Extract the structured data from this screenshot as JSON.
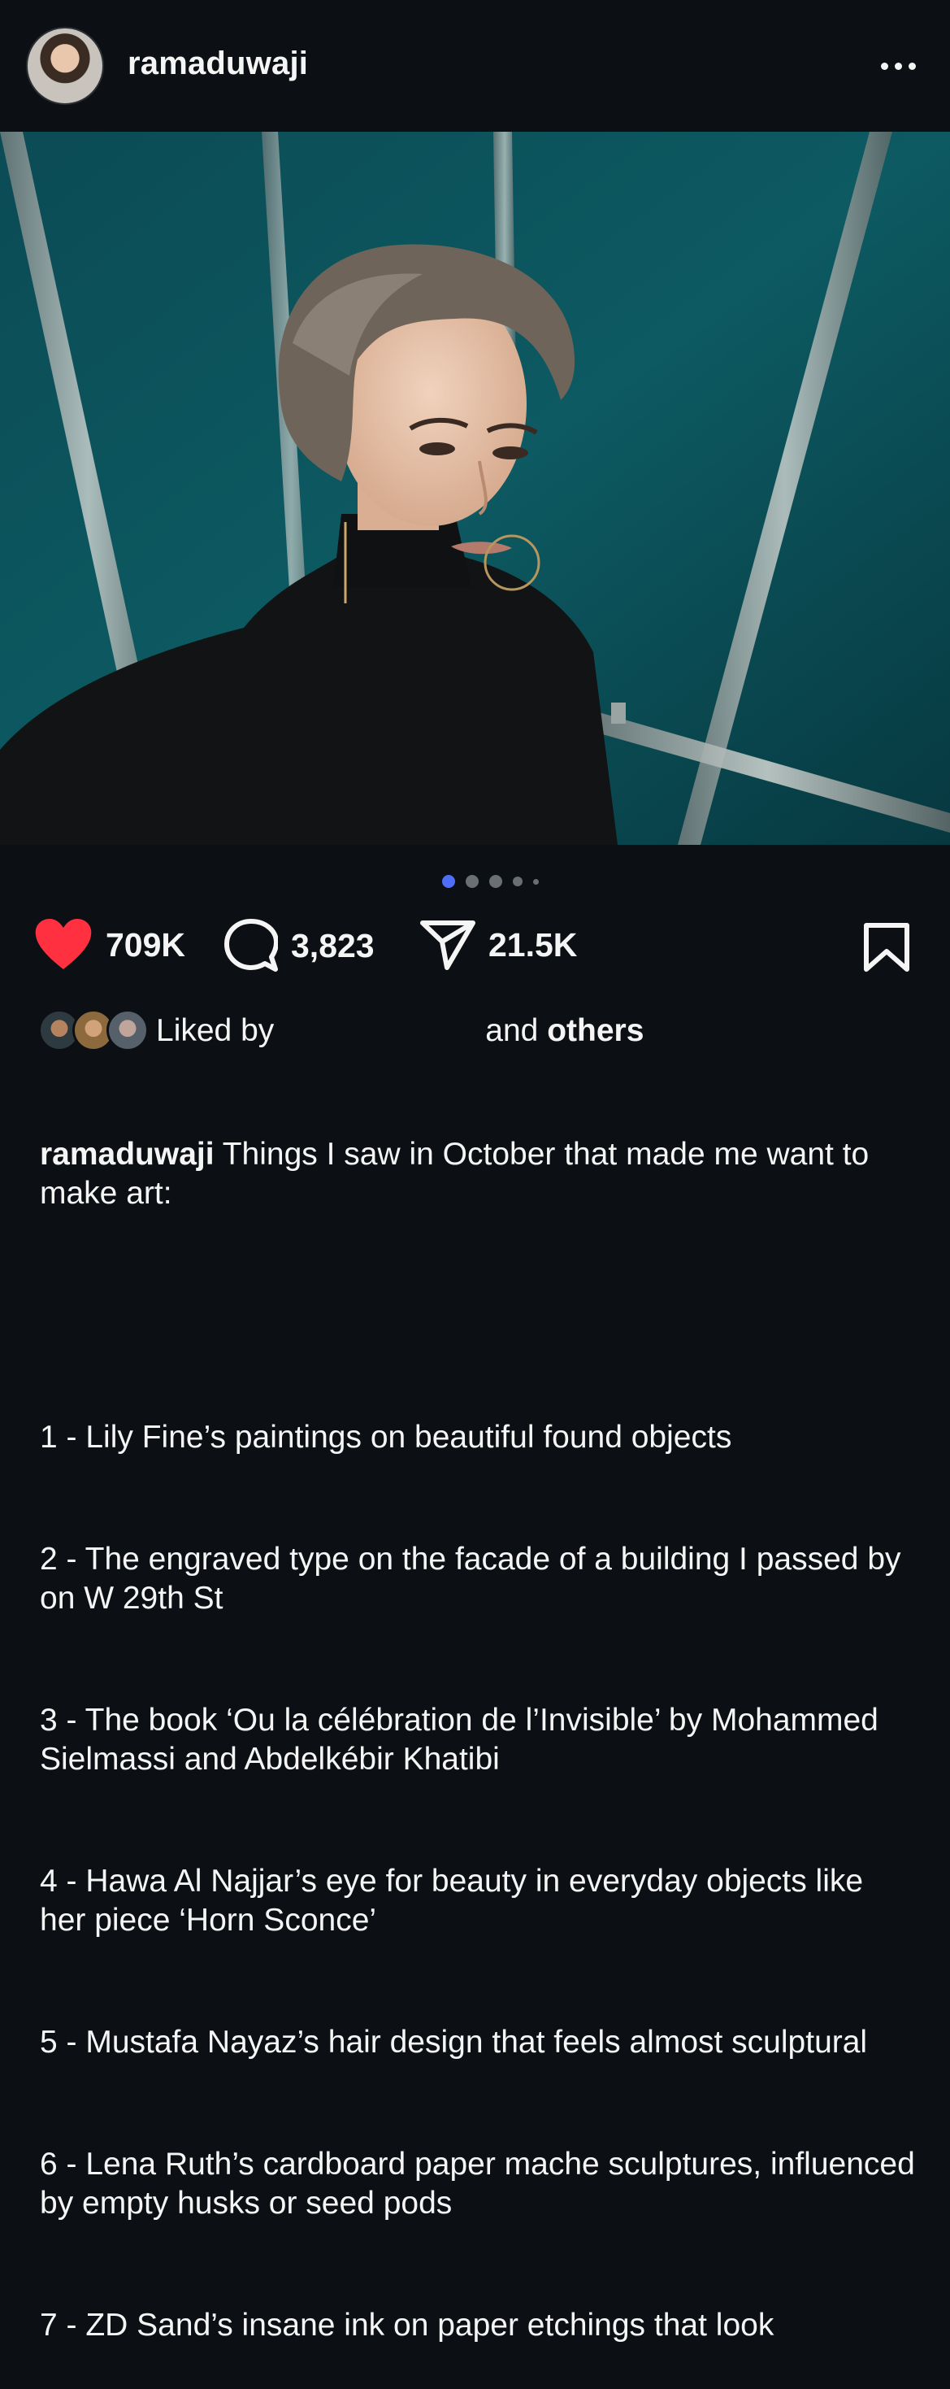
{
  "post": {
    "username": "ramaduwaji",
    "counts": {
      "likes": "709K",
      "comments": "3,823",
      "shares": "21.5K"
    },
    "carousel": {
      "total": 5,
      "active_index": 0
    },
    "liked_by": {
      "prefix": "Liked by",
      "mid": "and",
      "suffix": "others"
    },
    "caption": {
      "username": "ramaduwaji",
      "intro": " Things I saw in October that made me want to make art:",
      "items": [
        "1 - Lily Fine’s paintings on beautiful found objects",
        "2 - The engraved type on the facade of a building I passed by on W 29th St",
        "3 - The book ‘Ou la célébration de l’Invisible’ by Mohammed Sielmassi and Abdelkébir Khatibi",
        "4 - Hawa Al Najjar’s eye for beauty in everyday objects like her piece ‘Horn Sconce’",
        "5 - Mustafa Nayaz’s hair design that feels almost sculptural",
        "6 - Lena Ruth’s cardboard paper mache sculptures, influenced by empty husks or seed pods",
        "7 - ZD Sand’s insane ink on paper etchings that look"
      ]
    }
  },
  "colors": {
    "background": "#0c1014",
    "like_red": "#ff3040",
    "active_dot": "#4f6ef7"
  },
  "icons": {
    "more": "more-horizontal-icon",
    "like": "heart-filled-icon",
    "comment": "comment-bubble-icon",
    "share": "send-paper-plane-icon",
    "save": "bookmark-icon"
  }
}
